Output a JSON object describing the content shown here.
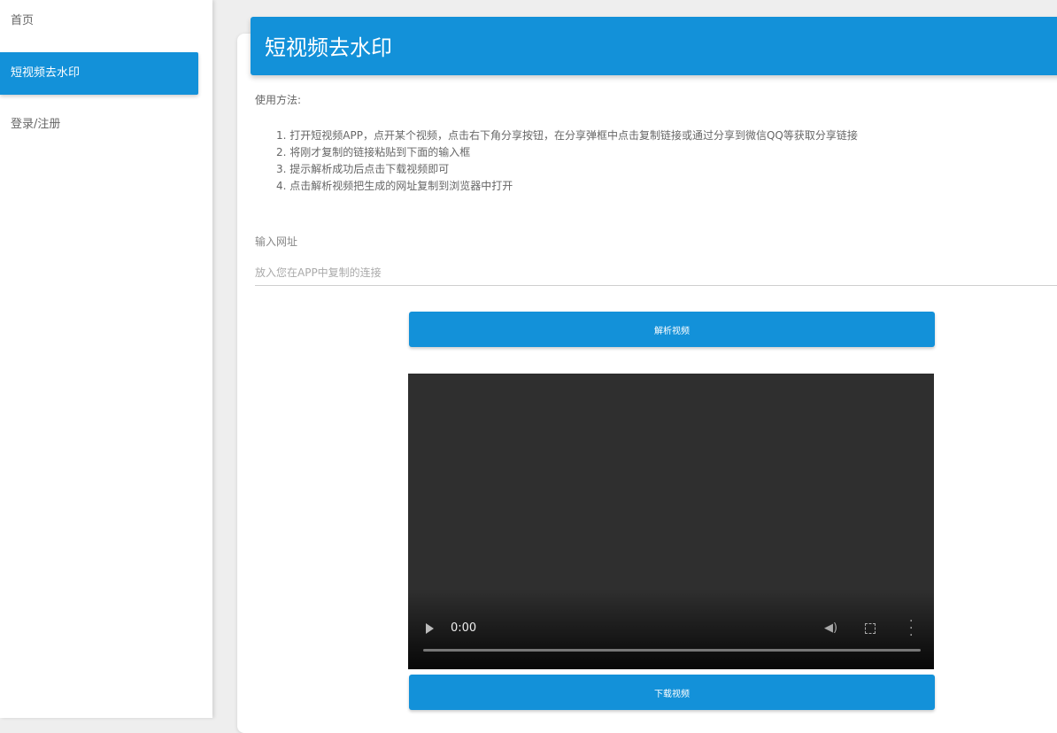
{
  "sidebar": {
    "items": [
      {
        "label": "首页"
      },
      {
        "label": "短视频去水印"
      },
      {
        "label": "登录/注册"
      }
    ]
  },
  "card": {
    "title": "短视频去水印",
    "usage_label": "使用方法:",
    "steps": [
      "1. 打开短视频APP，点开某个视频，点击右下角分享按钮，在分享弹框中点击复制链接或通过分享到微信QQ等获取分享链接",
      "2. 将刚才复制的链接粘贴到下面的输入框",
      "3. 提示解析成功后点击下载视频即可",
      "4. 点击解析视频把生成的网址复制到浏览器中打开"
    ],
    "input_label": "输入网址",
    "input_placeholder": "放入您在APP中复制的连接",
    "parse_button": "解析视频",
    "download_button": "下载视频"
  },
  "video": {
    "time": "0:00"
  },
  "colors": {
    "accent": "#1391d9"
  }
}
